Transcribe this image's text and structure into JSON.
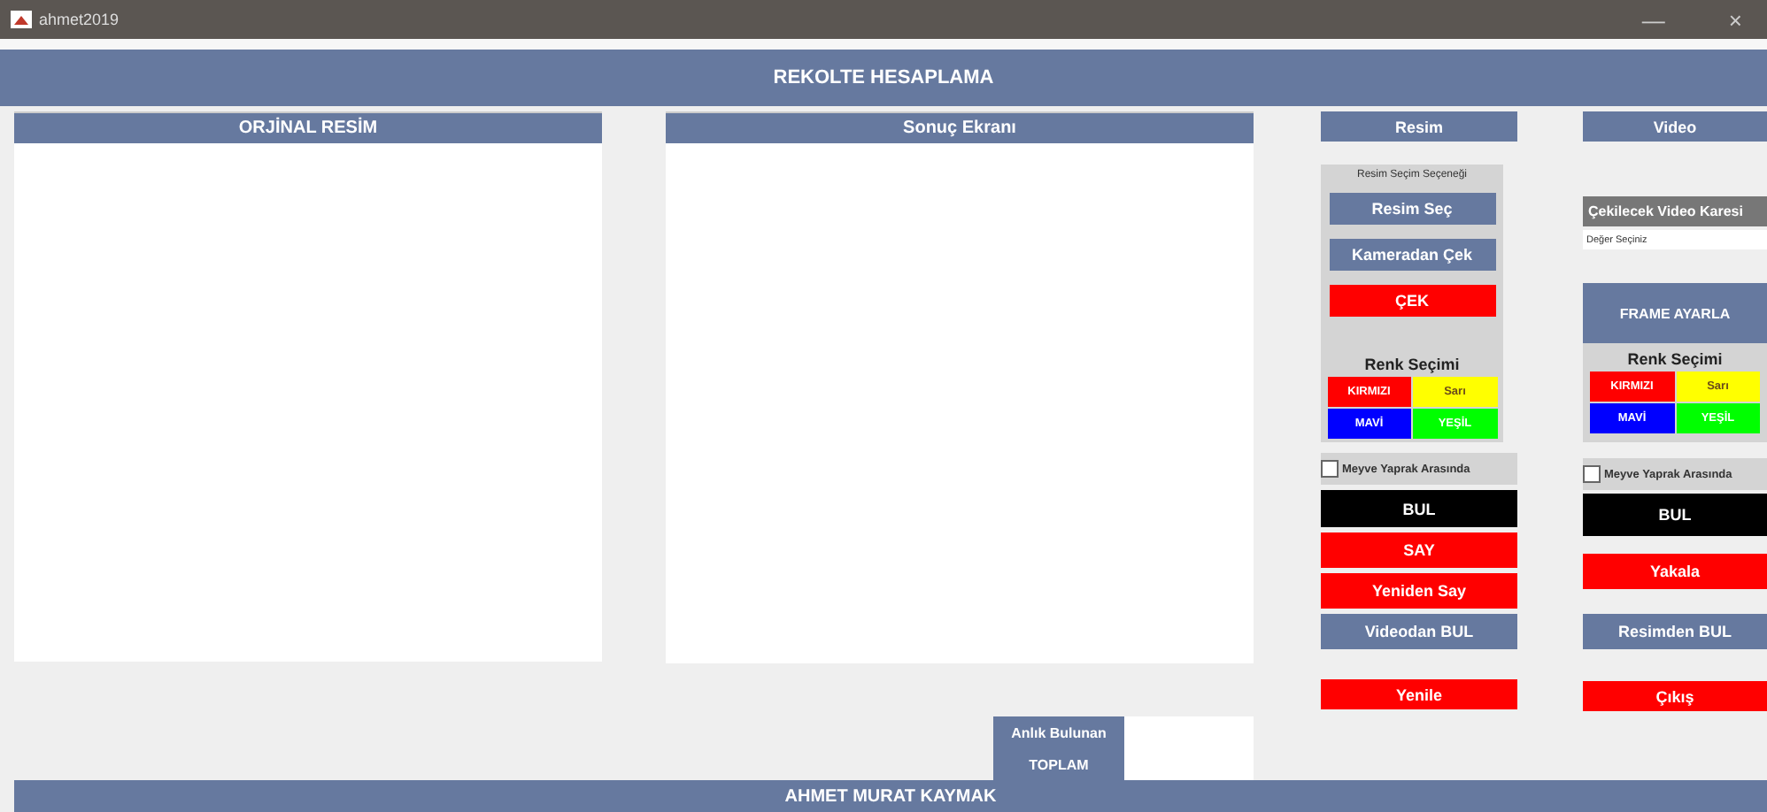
{
  "window": {
    "title": "ahmet2019",
    "controls": [
      "—",
      "×"
    ]
  },
  "header": "REKOLTE HESAPLAMA",
  "panels": [
    {
      "title": "ORJİNAL RESİM"
    },
    {
      "title": "Sonuç Ekranı"
    }
  ],
  "totals": [
    {
      "label": "Anlık Bulunan"
    },
    {
      "label": "TOPLAM"
    }
  ],
  "image_column": {
    "tab": "Resim",
    "group_title": "Resim Seçim Seçeneği",
    "source_buttons": [
      {
        "label": "Resim Seç",
        "kind": "primary"
      },
      {
        "label": "Kameradan Çek",
        "kind": "primary"
      },
      {
        "label": "ÇEK",
        "kind": "danger"
      }
    ],
    "color_title": "Renk Seçimi",
    "colors": [
      {
        "label": "KIRMIZI",
        "color": "#ff0000"
      },
      {
        "label": "Sarı",
        "color": "#ffff00"
      },
      {
        "label": "MAVİ",
        "color": "#0000ff"
      },
      {
        "label": "YEŞİL",
        "color": "#00ff00"
      }
    ],
    "checkbox": {
      "label": "Meyve Yaprak Arasında",
      "checked": false
    },
    "buttons": [
      {
        "label": "BUL",
        "kind": "dark"
      },
      {
        "label": "SAY",
        "kind": "danger"
      },
      {
        "label": "Yeniden Say",
        "kind": "danger"
      },
      {
        "label": "Videodan BUL",
        "kind": "primary"
      }
    ],
    "bottom_button": {
      "label": "Yenile",
      "kind": "danger"
    }
  },
  "video_column": {
    "tab": "Video",
    "frame_label": "Çekilecek Video Karesi",
    "frame_select": {
      "value": "Değer Seçiniz"
    },
    "frame_button": {
      "label": "FRAME AYARLA",
      "kind": "primary"
    },
    "color_title": "Renk Seçimi",
    "colors": [
      {
        "label": "KIRMIZI",
        "color": "#ff0000"
      },
      {
        "label": "Sarı",
        "color": "#ffff00"
      },
      {
        "label": "MAVİ",
        "color": "#0000ff"
      },
      {
        "label": "YEŞİL",
        "color": "#00ff00"
      }
    ],
    "checkbox": {
      "label": "Meyve Yaprak Arasında",
      "checked": false
    },
    "buttons": [
      {
        "label": "BUL",
        "kind": "dark"
      },
      {
        "label": "Yakala",
        "kind": "danger"
      },
      {
        "label": "Resimden BUL",
        "kind": "primary"
      }
    ],
    "bottom_button": {
      "label": "Çıkış",
      "kind": "danger"
    }
  },
  "footer": "AHMET MURAT KAYMAK"
}
